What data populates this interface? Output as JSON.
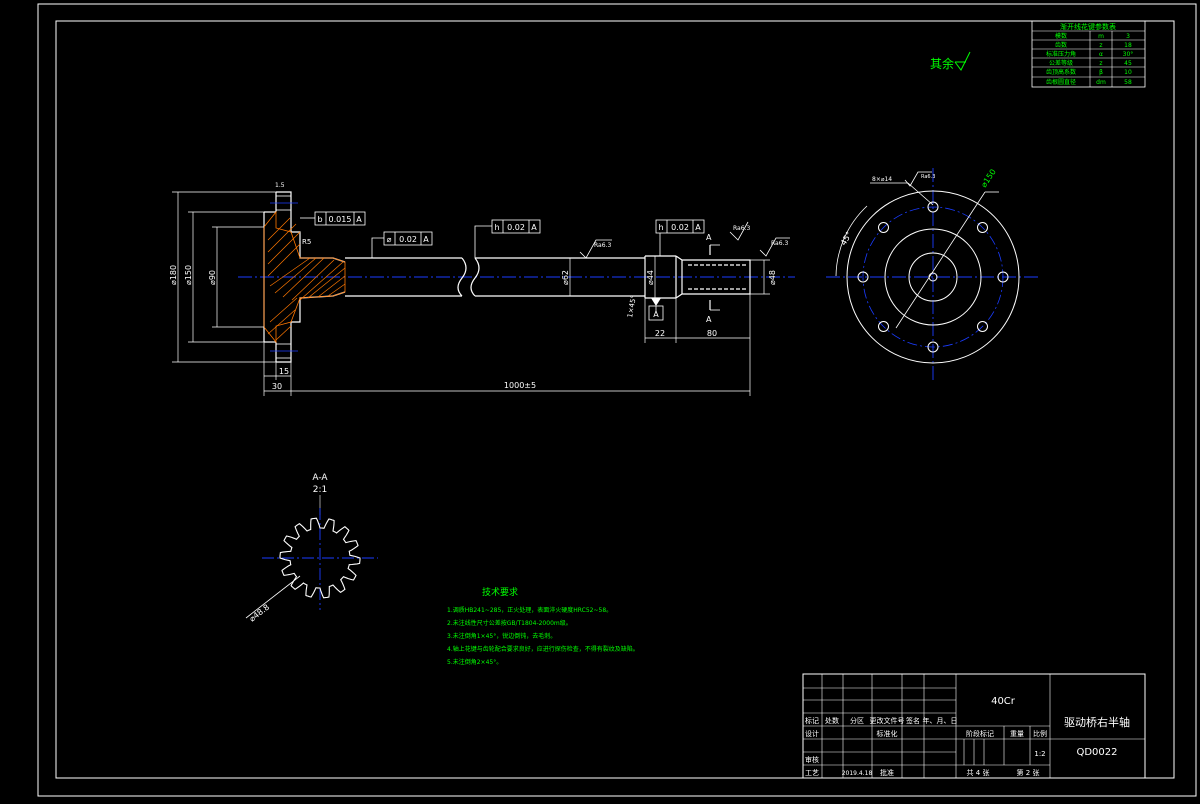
{
  "colors": {
    "background": "#000000",
    "frame": "#ffffff",
    "outline": "#ffffff",
    "center_line": "#1a3cff",
    "dimension": "#ffffff",
    "annotation": "#00ff00",
    "hidden_shade": "#ff9900",
    "hatch": "#ff7700"
  },
  "surface_finish": {
    "global_symbol_label": "其余"
  },
  "gear_table": {
    "title": "渐开线花键参数表",
    "rows": [
      {
        "name": "模数",
        "symbol": "m",
        "value": "3"
      },
      {
        "name": "齿数",
        "symbol": "z",
        "value": "18"
      },
      {
        "name": "标准压力角",
        "symbol": "α",
        "value": "30°"
      },
      {
        "name": "公差等级",
        "symbol": "z",
        "value": "45"
      },
      {
        "name": "齿顶高系数",
        "symbol": "β",
        "value": "10"
      },
      {
        "name": "齿根圆直径",
        "symbol": "dm",
        "value": "58"
      }
    ]
  },
  "main_view": {
    "tolerance_frames": [
      {
        "symbol": "b",
        "value": "0.015",
        "datum": "A"
      },
      {
        "symbol": "⌀",
        "value": "0.02",
        "datum": "A"
      },
      {
        "symbol": "h",
        "value": "0.02",
        "datum": "A"
      },
      {
        "symbol": "h",
        "value": "0.02",
        "datum": "A"
      }
    ],
    "dimensions": {
      "d1": "⌀180",
      "d2": "⌀150",
      "d3": "⌀90",
      "d4": "⌀62",
      "d5": "⌀44",
      "d6": "⌀48",
      "len_flange": "30",
      "len_hub": "15",
      "len_total": "1000±5",
      "len_a": "22",
      "len_b": "80",
      "chamfer": "1×45°",
      "radius": "R5",
      "top_mark": "1.5"
    },
    "section_marker": "A",
    "datum_label": "A",
    "roughness": [
      "Ra6.3",
      "Ra6.3",
      "Ra6.3"
    ]
  },
  "side_view": {
    "angle": "45°",
    "bolt_circle": "⌀150",
    "hole_label": "8×⌀14",
    "roughness": "Ra6.3"
  },
  "section_view": {
    "title": "A-A",
    "scale": "2:1",
    "diameter": "⌀48.8"
  },
  "tech_notes": {
    "title": "技术要求",
    "items": [
      "1.调质HB241~285，正火处理，表面淬火硬度HRC52~58。",
      "2.未注线性尺寸公差按GB/T1804-2000m级。",
      "3.未注倒角1×45°，锐边倒钝，去毛刺。",
      "4.轴上花键与齿轮配合要求良好，应进行探伤检查，不得有裂纹及缺陷。",
      "5.未注倒角2×45°。"
    ]
  },
  "title_block": {
    "material": "40Cr",
    "part_name": "驱动桥右半轴",
    "drawing_no": "QD0022",
    "scale_label": "比例",
    "scale_value": "1:2",
    "stage_label": "阶段标记",
    "weight_label": "重量",
    "sheet_text": "共 4 张",
    "sheet_no": "第 2 张",
    "header_cells": [
      "标记",
      "处数",
      "分区",
      "更改文件号",
      "签名",
      "年、月、日"
    ],
    "design": "设计",
    "standard": "标准化",
    "check": "审核",
    "process": "工艺",
    "approve": "批准",
    "designer_name": "",
    "date": "2019.4.18"
  }
}
